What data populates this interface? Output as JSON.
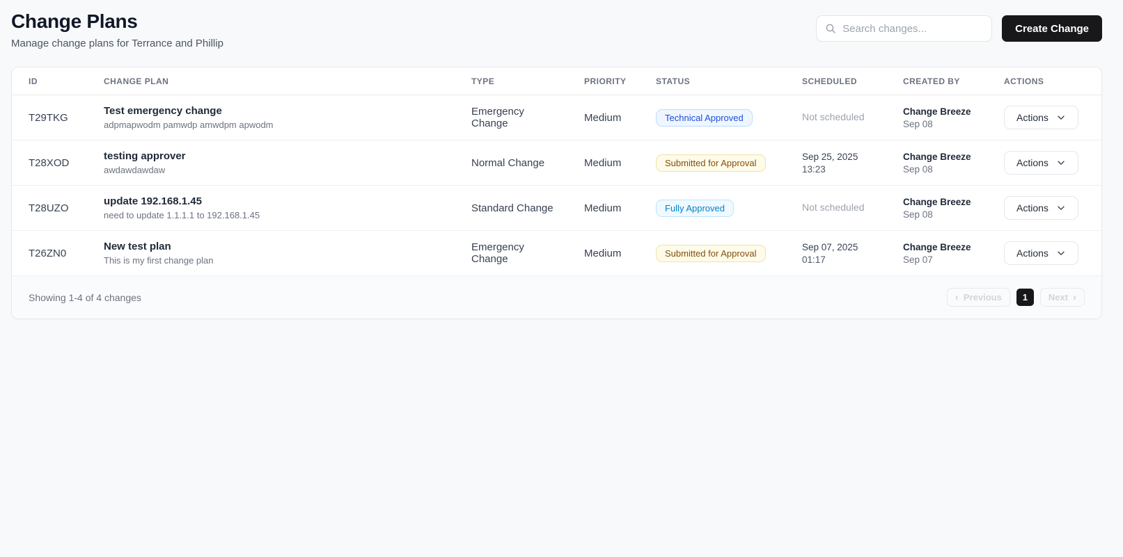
{
  "page": {
    "title": "Change Plans",
    "subtitle": "Manage change plans for Terrance and Phillip"
  },
  "toolbar": {
    "search_placeholder": "Search changes...",
    "create_label": "Create Change"
  },
  "table": {
    "columns": {
      "id": "ID",
      "plan": "CHANGE PLAN",
      "type": "TYPE",
      "priority": "PRIORITY",
      "status": "STATUS",
      "scheduled": "SCHEDULED",
      "created": "CREATED BY",
      "actions": "ACTIONS"
    },
    "rows": [
      {
        "id": "T29TKG",
        "title": "Test emergency change",
        "description": "adpmapwodm pamwdp amwdpm apwodm",
        "type": "Emergency Change",
        "priority": "Medium",
        "status": "Technical Approved",
        "status_variant": "blue",
        "scheduled_date": "Not scheduled",
        "scheduled_time": "",
        "scheduled_variant": "muted",
        "created_by": "Change Breeze",
        "created_date": "Sep 08",
        "actions_label": "Actions"
      },
      {
        "id": "T28XOD",
        "title": "testing approver",
        "description": "awdawdawdaw",
        "type": "Normal Change",
        "priority": "Medium",
        "status": "Submitted for Approval",
        "status_variant": "amber",
        "scheduled_date": "Sep 25, 2025",
        "scheduled_time": "13:23",
        "scheduled_variant": "normal",
        "created_by": "Change Breeze",
        "created_date": "Sep 08",
        "actions_label": "Actions"
      },
      {
        "id": "T28UZO",
        "title": "update 192.168.1.45",
        "description": "need to update 1.1.1.1 to 192.168.1.45",
        "type": "Standard Change",
        "priority": "Medium",
        "status": "Fully Approved",
        "status_variant": "sky",
        "scheduled_date": "Not scheduled",
        "scheduled_time": "",
        "scheduled_variant": "muted",
        "created_by": "Change Breeze",
        "created_date": "Sep 08",
        "actions_label": "Actions"
      },
      {
        "id": "T26ZN0",
        "title": "New test plan",
        "description": "This is my first change plan",
        "type": "Emergency Change",
        "priority": "Medium",
        "status": "Submitted for Approval",
        "status_variant": "amber",
        "scheduled_date": "Sep 07, 2025",
        "scheduled_time": "01:17",
        "scheduled_variant": "normal",
        "created_by": "Change Breeze",
        "created_date": "Sep 07",
        "actions_label": "Actions"
      }
    ]
  },
  "footer": {
    "summary": "Showing 1-4 of 4 changes",
    "previous_label": "Previous",
    "page_number": "1",
    "next_label": "Next"
  },
  "icons": {
    "chevron_left": "‹",
    "chevron_right": "›"
  },
  "colors": {
    "accent_dark": "#18181b",
    "page_background": "#f8f9fb",
    "status_blue_text": "#1d4ed8",
    "status_blue_bg": "#eff6ff",
    "status_amber_text": "#854d0e",
    "status_amber_bg": "#fefce8",
    "status_sky_text": "#0284c7",
    "status_sky_bg": "#f0f9ff"
  }
}
